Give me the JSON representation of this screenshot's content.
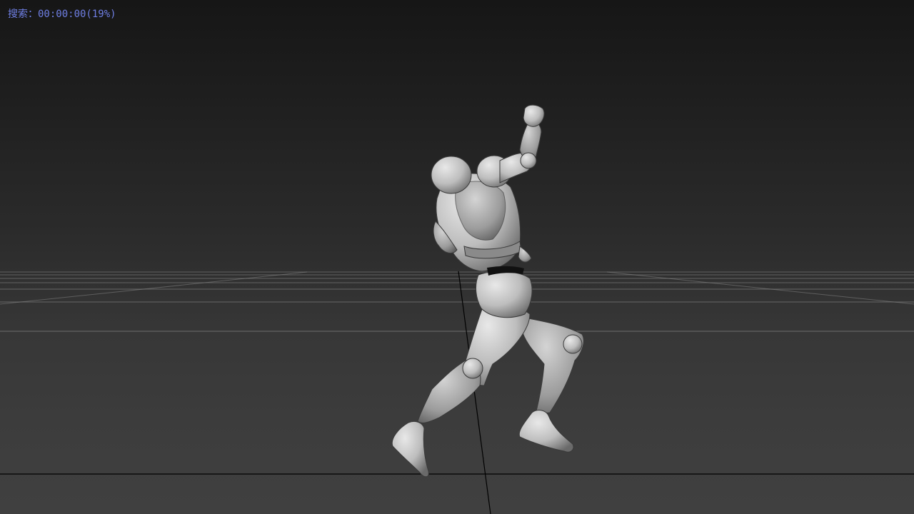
{
  "viewport": {
    "status_text": "搜索：00:00:00(19%)",
    "status_color": "#6f7fe4",
    "background_top": "#161616",
    "background_bottom": "#404040",
    "grid_color": "#8a8a8a",
    "axis_color": "#000000"
  },
  "scene": {
    "object": "character-model",
    "model_color": "#c9c9c9"
  }
}
